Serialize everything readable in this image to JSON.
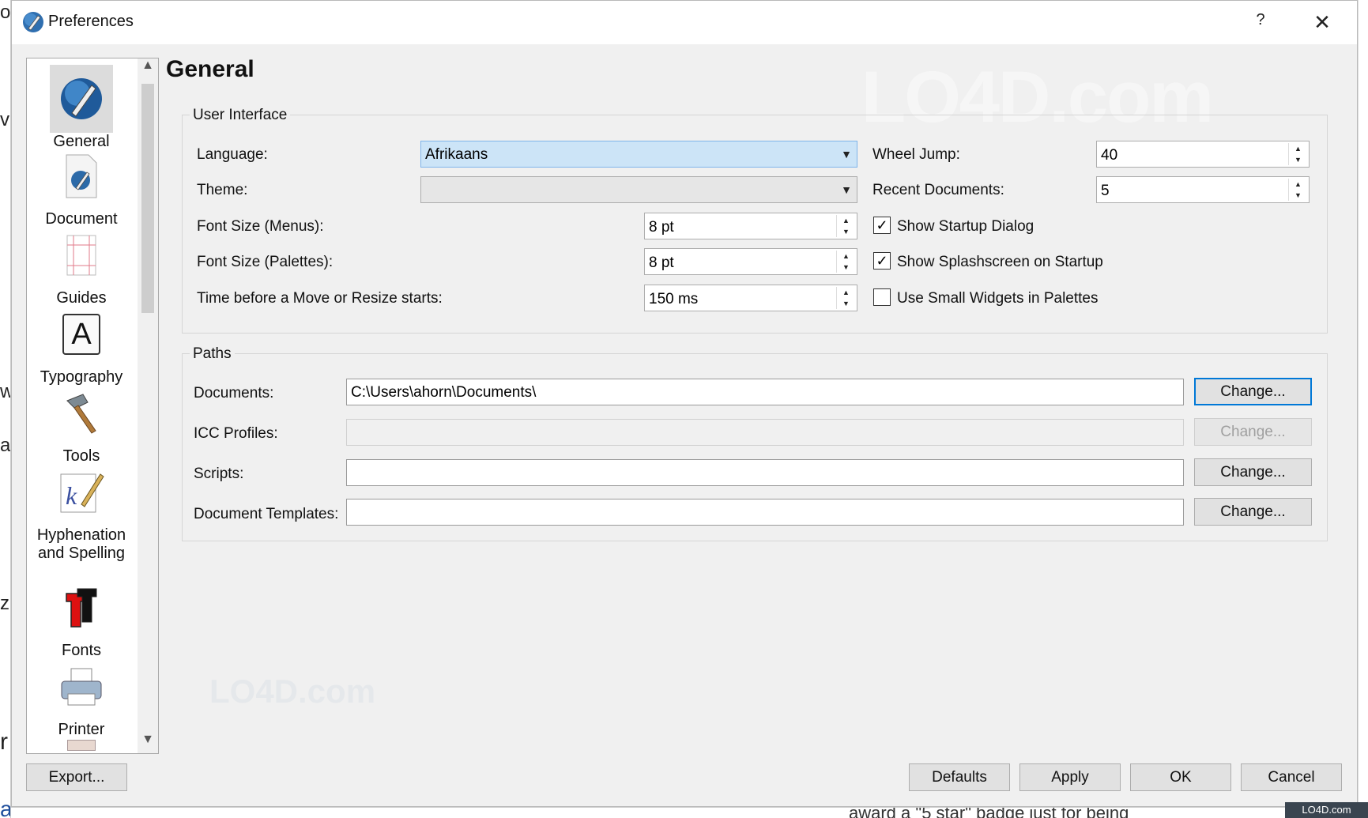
{
  "window": {
    "title": "Preferences",
    "help_glyph": "?",
    "close_glyph": "✕"
  },
  "background": {
    "left_fragments": [
      "o",
      "ve",
      "w",
      "ar",
      "z",
      "r",
      "ags"
    ],
    "bottom_text": "award a \"5 star\" badge just for being"
  },
  "sidebar": {
    "items": [
      {
        "label": "General",
        "icon": "scribus-icon",
        "selected": true
      },
      {
        "label": "Document",
        "icon": "document-icon"
      },
      {
        "label": "Guides",
        "icon": "guides-icon"
      },
      {
        "label": "Typography",
        "icon": "typography-icon",
        "glyph": "A"
      },
      {
        "label": "Tools",
        "icon": "hammer-icon"
      },
      {
        "label": "Hyphenation and Spelling",
        "label1": "Hyphenation",
        "label2": "and Spelling",
        "icon": "hyphenation-icon"
      },
      {
        "label": "Fonts",
        "icon": "fonts-icon"
      },
      {
        "label": "Printer",
        "icon": "printer-icon"
      }
    ]
  },
  "page": {
    "heading": "General"
  },
  "ui": {
    "group_label": "User Interface",
    "language_label": "Language:",
    "language_value": "Afrikaans",
    "theme_label": "Theme:",
    "theme_value": "",
    "font_menus_label": "Font Size (Menus):",
    "font_menus_value": "8 pt",
    "font_palettes_label": "Font Size (Palettes):",
    "font_palettes_value": "8 pt",
    "time_label": "Time before a Move or Resize starts:",
    "time_value": "150 ms",
    "wheel_label": "Wheel Jump:",
    "wheel_value": "40",
    "recent_label": "Recent Documents:",
    "recent_value": "5",
    "startup_label": "Show Startup Dialog",
    "startup_checked": true,
    "splash_label": "Show Splashscreen on Startup",
    "splash_checked": true,
    "small_widgets_label": "Use Small Widgets in Palettes",
    "small_widgets_checked": false
  },
  "paths": {
    "group_label": "Paths",
    "documents_label": "Documents:",
    "documents_value": "C:\\Users\\ahorn\\Documents\\",
    "icc_label": "ICC Profiles:",
    "icc_value": "",
    "scripts_label": "Scripts:",
    "scripts_value": "",
    "templates_label": "Document Templates:",
    "templates_value": "",
    "change_label": "Change..."
  },
  "footer": {
    "export_label": "Export...",
    "defaults_label": "Defaults",
    "apply_label": "Apply",
    "ok_label": "OK",
    "cancel_label": "Cancel"
  },
  "watermark": {
    "text": "LO4D.com"
  }
}
